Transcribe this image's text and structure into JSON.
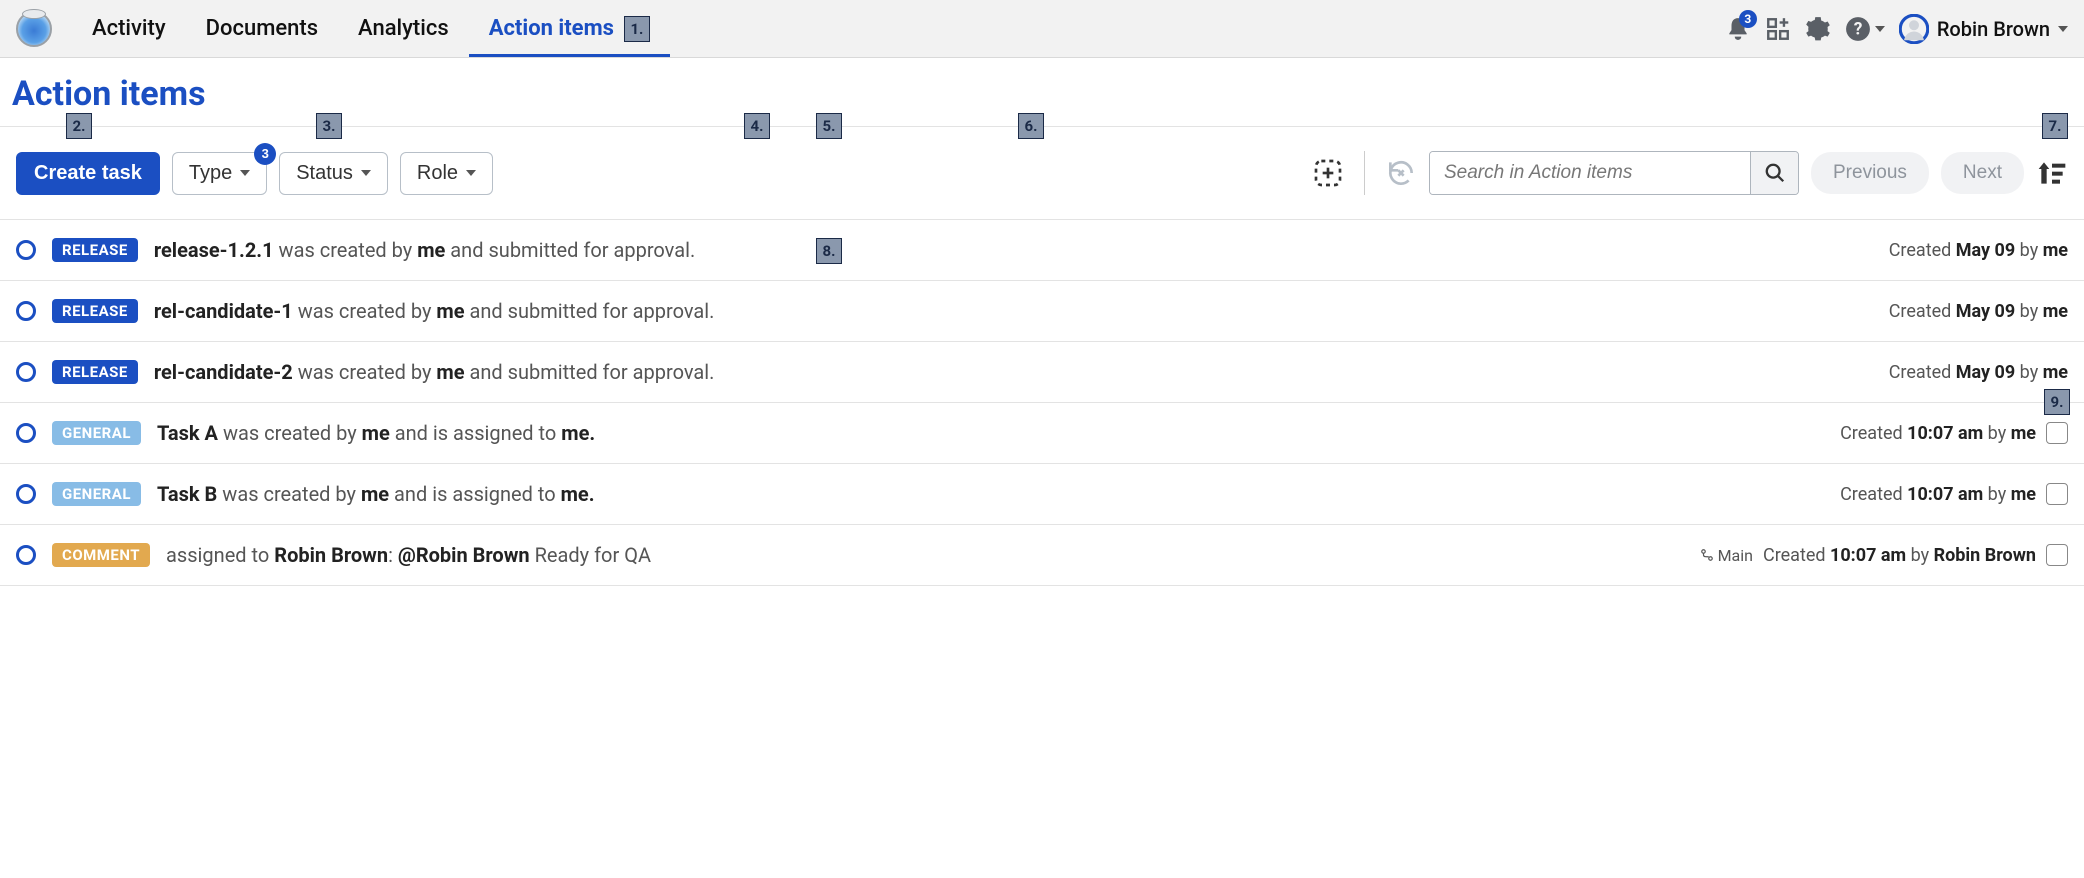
{
  "nav": {
    "items": [
      "Activity",
      "Documents",
      "Analytics",
      "Action items"
    ],
    "active_index": 3,
    "active_badge": "1."
  },
  "user": {
    "name": "Robin Brown",
    "notifications": "3"
  },
  "page": {
    "title": "Action items"
  },
  "toolbar": {
    "create_label": "Create task",
    "filters": [
      {
        "label": "Type",
        "badge": "3"
      },
      {
        "label": "Status"
      },
      {
        "label": "Role"
      }
    ],
    "search_placeholder": "Search in Action items",
    "prev_label": "Previous",
    "next_label": "Next",
    "overlays": {
      "n2": "2.",
      "n3": "3.",
      "n4": "4.",
      "n5": "5.",
      "n6": "6.",
      "n7": "7.",
      "n8": "8.",
      "n9": "9."
    }
  },
  "rows": [
    {
      "tag": "RELEASE",
      "tag_class": "tag-release",
      "subject": "release-1.2.1",
      "mid1": " was created by ",
      "actor": "me",
      "mid2": " and submitted for approval.",
      "assignee": "",
      "tail": "",
      "meta_prefix": "Created ",
      "meta_time": "May 09",
      "meta_by": " by ",
      "meta_author": "me",
      "checkbox": false,
      "branch": ""
    },
    {
      "tag": "RELEASE",
      "tag_class": "tag-release",
      "subject": "rel-candidate-1",
      "mid1": " was created by ",
      "actor": "me",
      "mid2": " and submitted for approval.",
      "assignee": "",
      "tail": "",
      "meta_prefix": "Created ",
      "meta_time": "May 09",
      "meta_by": " by ",
      "meta_author": "me",
      "checkbox": false,
      "branch": ""
    },
    {
      "tag": "RELEASE",
      "tag_class": "tag-release",
      "subject": "rel-candidate-2",
      "mid1": " was created by ",
      "actor": "me",
      "mid2": " and submitted for approval.",
      "assignee": "",
      "tail": "",
      "meta_prefix": "Created ",
      "meta_time": "May 09",
      "meta_by": " by ",
      "meta_author": "me",
      "checkbox": false,
      "branch": ""
    },
    {
      "tag": "GENERAL",
      "tag_class": "tag-general",
      "subject": "Task A",
      "mid1": " was created by ",
      "actor": "me",
      "mid2": " and is assigned to ",
      "assignee": "me.",
      "tail": "",
      "meta_prefix": "Created ",
      "meta_time": "10:07 am",
      "meta_by": " by ",
      "meta_author": "me",
      "checkbox": true,
      "branch": ""
    },
    {
      "tag": "GENERAL",
      "tag_class": "tag-general",
      "subject": "Task B",
      "mid1": " was created by ",
      "actor": "me",
      "mid2": " and is assigned to ",
      "assignee": "me.",
      "tail": "",
      "meta_prefix": "Created ",
      "meta_time": "10:07 am",
      "meta_by": " by ",
      "meta_author": "me",
      "checkbox": true,
      "branch": ""
    },
    {
      "tag": "COMMENT",
      "tag_class": "tag-comment",
      "subject": "",
      "mid1": "  assigned to ",
      "actor": "Robin Brown",
      "mid2": ":   ",
      "assignee": "@Robin Brown",
      "tail": " Ready for QA",
      "meta_prefix": "Created ",
      "meta_time": "10:07 am",
      "meta_by": " by ",
      "meta_author": "Robin Brown",
      "checkbox": true,
      "branch": "Main"
    }
  ]
}
